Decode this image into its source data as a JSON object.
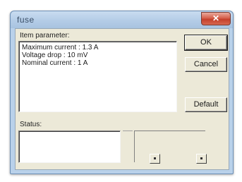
{
  "window": {
    "title": "fuse",
    "close_glyph": "✕"
  },
  "params": {
    "label": "Item parameter:",
    "lines": [
      "Maximum current : 1.3  A",
      "Voltage drop : 10  mV",
      "Nominal current : 1  A"
    ]
  },
  "buttons": {
    "ok": "OK",
    "cancel": "Cancel",
    "default": "Default"
  },
  "status": {
    "label": "Status:"
  },
  "icons": {
    "close": "close-icon",
    "spin_left": "small-button-icon",
    "spin_right": "small-button-icon"
  },
  "colors": {
    "titlebar": "#b2cbe6",
    "close_button": "#c4402b",
    "client": "#ece9d8"
  }
}
